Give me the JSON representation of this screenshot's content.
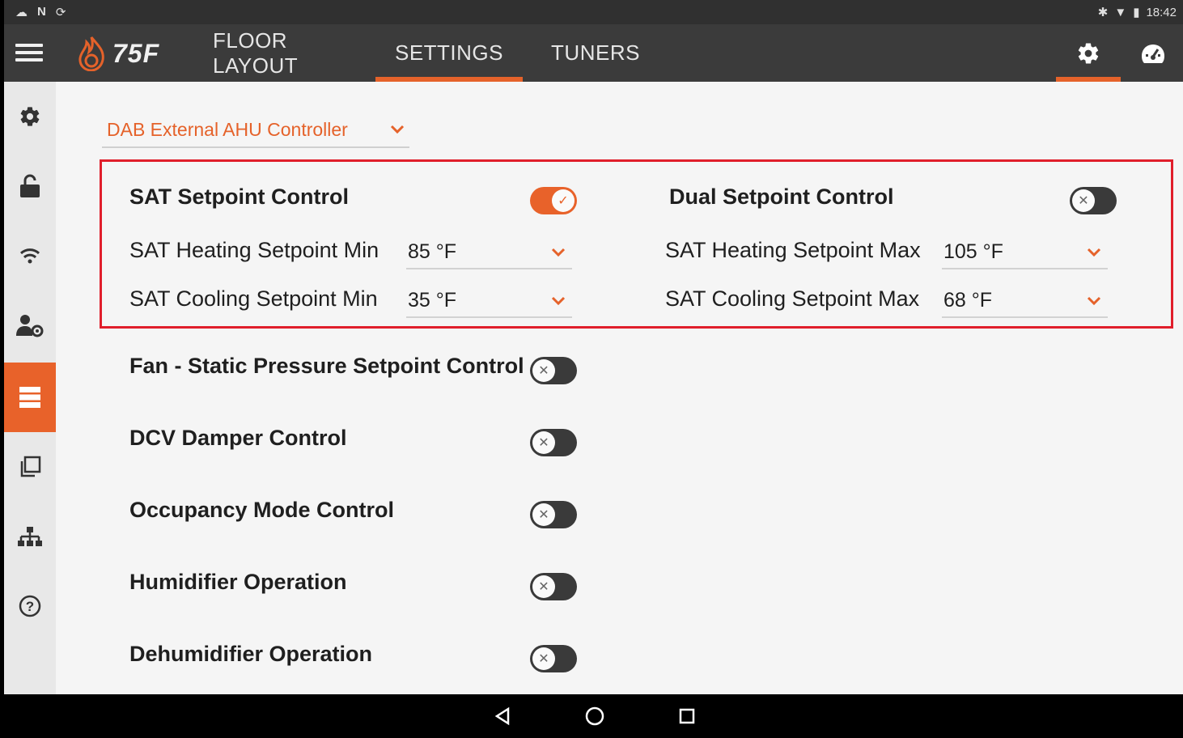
{
  "statusbar": {
    "time": "18:42",
    "left_icons": [
      "cloud-icon",
      "n-icon",
      "sync-icon"
    ],
    "right_icons": [
      "bluetooth-icon",
      "wifi-icon",
      "battery-icon"
    ]
  },
  "header": {
    "brand": "75F",
    "tabs": [
      {
        "label": "FLOOR LAYOUT",
        "active": false
      },
      {
        "label": "SETTINGS",
        "active": true
      },
      {
        "label": "TUNERS",
        "active": false
      }
    ],
    "accent": "#e5622a"
  },
  "sidebar": {
    "items": [
      {
        "icon": "gear-icon",
        "active": false
      },
      {
        "icon": "unlock-icon",
        "active": false
      },
      {
        "icon": "wifi-icon",
        "active": false
      },
      {
        "icon": "user-settings-icon",
        "active": false
      },
      {
        "icon": "server-list-icon",
        "active": true
      },
      {
        "icon": "copy-icon",
        "active": false
      },
      {
        "icon": "network-icon",
        "active": false
      },
      {
        "icon": "help-icon",
        "active": false
      }
    ]
  },
  "profile": {
    "selected": "DAB External AHU Controller"
  },
  "settings": {
    "sat_setpoint_control": {
      "label": "SAT Setpoint Control",
      "on": true
    },
    "dual_setpoint_control": {
      "label": "Dual Setpoint Control",
      "on": false
    },
    "sat_heating_min": {
      "label": "SAT Heating Setpoint Min",
      "value": "85 °F"
    },
    "sat_cooling_min": {
      "label": "SAT Cooling Setpoint Min",
      "value": "35 °F"
    },
    "sat_heating_max": {
      "label": "SAT Heating Setpoint Max",
      "value": "105 °F"
    },
    "sat_cooling_max": {
      "label": "SAT Cooling Setpoint Max",
      "value": "68 °F"
    },
    "fan_static": {
      "label": "Fan - Static Pressure Setpoint Control",
      "on": false
    },
    "dcv_damper": {
      "label": "DCV Damper Control",
      "on": false
    },
    "occupancy_mode": {
      "label": "Occupancy Mode Control",
      "on": false
    },
    "humidifier": {
      "label": "Humidifier Operation",
      "on": false
    },
    "dehumidifier": {
      "label": "Dehumidifier Operation",
      "on": false
    }
  },
  "highlight_color": "#e01e2b"
}
